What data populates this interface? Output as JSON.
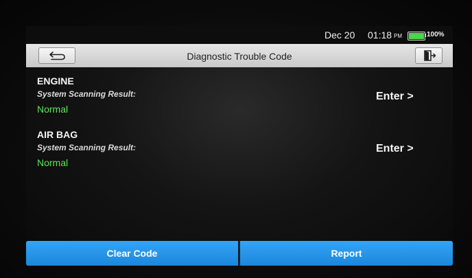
{
  "status_bar": {
    "date": "Dec 20",
    "time": "01:18",
    "ampm": "PM",
    "battery_text": "100%",
    "battery_level": 1.0,
    "battery_color": "#4cd64a"
  },
  "header": {
    "title": "Diagnostic Trouble Code",
    "back_icon": "back-arrow-icon",
    "exit_icon": "exit-door-icon"
  },
  "systems": [
    {
      "name": "ENGINE",
      "label": "System Scanning Result:",
      "status": "Normal",
      "action": "Enter >"
    },
    {
      "name": "AIR BAG",
      "label": "System Scanning Result:",
      "status": "Normal",
      "action": "Enter >"
    }
  ],
  "footer": {
    "clear_label": "Clear Code",
    "report_label": "Report"
  },
  "colors": {
    "status_ok": "#5ae65a",
    "button_blue": "#2a96e8"
  }
}
